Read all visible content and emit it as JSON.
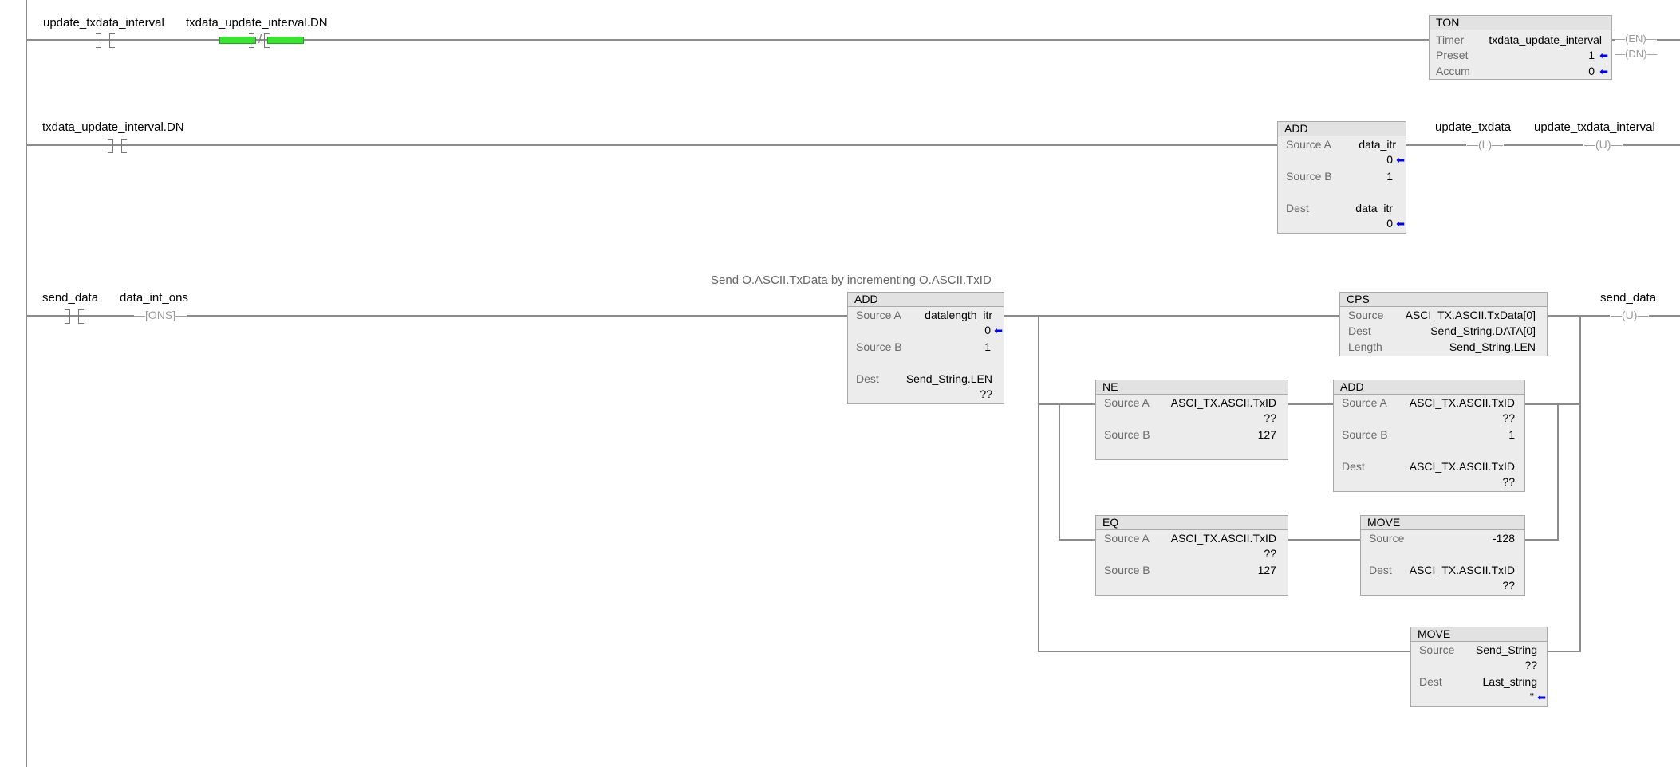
{
  "rung0": {
    "contact1_tag": "update_txdata_interval",
    "contact2_tag": "txdata_update_interval.DN",
    "ton": {
      "title": "TON",
      "timer_label": "Timer",
      "timer_value": "txdata_update_interval",
      "preset_label": "Preset",
      "preset_value": "1",
      "accum_label": "Accum",
      "accum_value": "0",
      "en_pin": "EN",
      "dn_pin": "DN"
    }
  },
  "rung1": {
    "contact_tag": "txdata_update_interval.DN",
    "add": {
      "title": "ADD",
      "source_a_label": "Source A",
      "source_a_tag": "data_itr",
      "source_a_value": "0",
      "source_b_label": "Source B",
      "source_b_value": "1",
      "dest_label": "Dest",
      "dest_tag": "data_itr",
      "dest_value": "0"
    },
    "coil_latch_tag": "update_txdata",
    "coil_latch_sym": "L",
    "coil_unlatch_tag": "update_txdata_interval",
    "coil_unlatch_sym": "U"
  },
  "rung2": {
    "comment": "Send O.ASCII.TxData by incrementing O.ASCII.TxID",
    "contact_tag": "send_data",
    "ons_tag": "data_int_ons",
    "ons_label": "ONS",
    "add": {
      "title": "ADD",
      "source_a_label": "Source A",
      "source_a_tag": "datalength_itr",
      "source_a_value": "0",
      "source_b_label": "Source B",
      "source_b_value": "1",
      "dest_label": "Dest",
      "dest_tag": "Send_String.LEN",
      "dest_value": "??"
    },
    "cps": {
      "title": "CPS",
      "source_label": "Source",
      "source_value": "ASCI_TX.ASCII.TxData[0]",
      "dest_label": "Dest",
      "dest_value": "Send_String.DATA[0]",
      "length_label": "Length",
      "length_value": "Send_String.LEN"
    },
    "ne": {
      "title": "NE",
      "source_a_label": "Source A",
      "source_a_tag": "ASCI_TX.ASCII.TxID",
      "source_a_value": "??",
      "source_b_label": "Source B",
      "source_b_value": "127"
    },
    "add2": {
      "title": "ADD",
      "source_a_label": "Source A",
      "source_a_tag": "ASCI_TX.ASCII.TxID",
      "source_a_value": "??",
      "source_b_label": "Source B",
      "source_b_value": "1",
      "dest_label": "Dest",
      "dest_tag": "ASCI_TX.ASCII.TxID",
      "dest_value": "??"
    },
    "eq": {
      "title": "EQ",
      "source_a_label": "Source A",
      "source_a_tag": "ASCI_TX.ASCII.TxID",
      "source_a_value": "??",
      "source_b_label": "Source B",
      "source_b_value": "127"
    },
    "move1": {
      "title": "MOVE",
      "source_label": "Source",
      "source_value": "-128",
      "dest_label": "Dest",
      "dest_tag": "ASCI_TX.ASCII.TxID",
      "dest_value": "??"
    },
    "move2": {
      "title": "MOVE",
      "source_label": "Source",
      "source_tag": "Send_String",
      "source_value": "??",
      "dest_label": "Dest",
      "dest_tag": "Last_string",
      "dest_value": "''"
    },
    "coil_tag": "send_data",
    "coil_sym": "U"
  },
  "colors": {
    "rail": "#8c8c8c",
    "block_fill": "#ececec",
    "energized": "#35e52e",
    "value_arrow": "#0000ee"
  }
}
